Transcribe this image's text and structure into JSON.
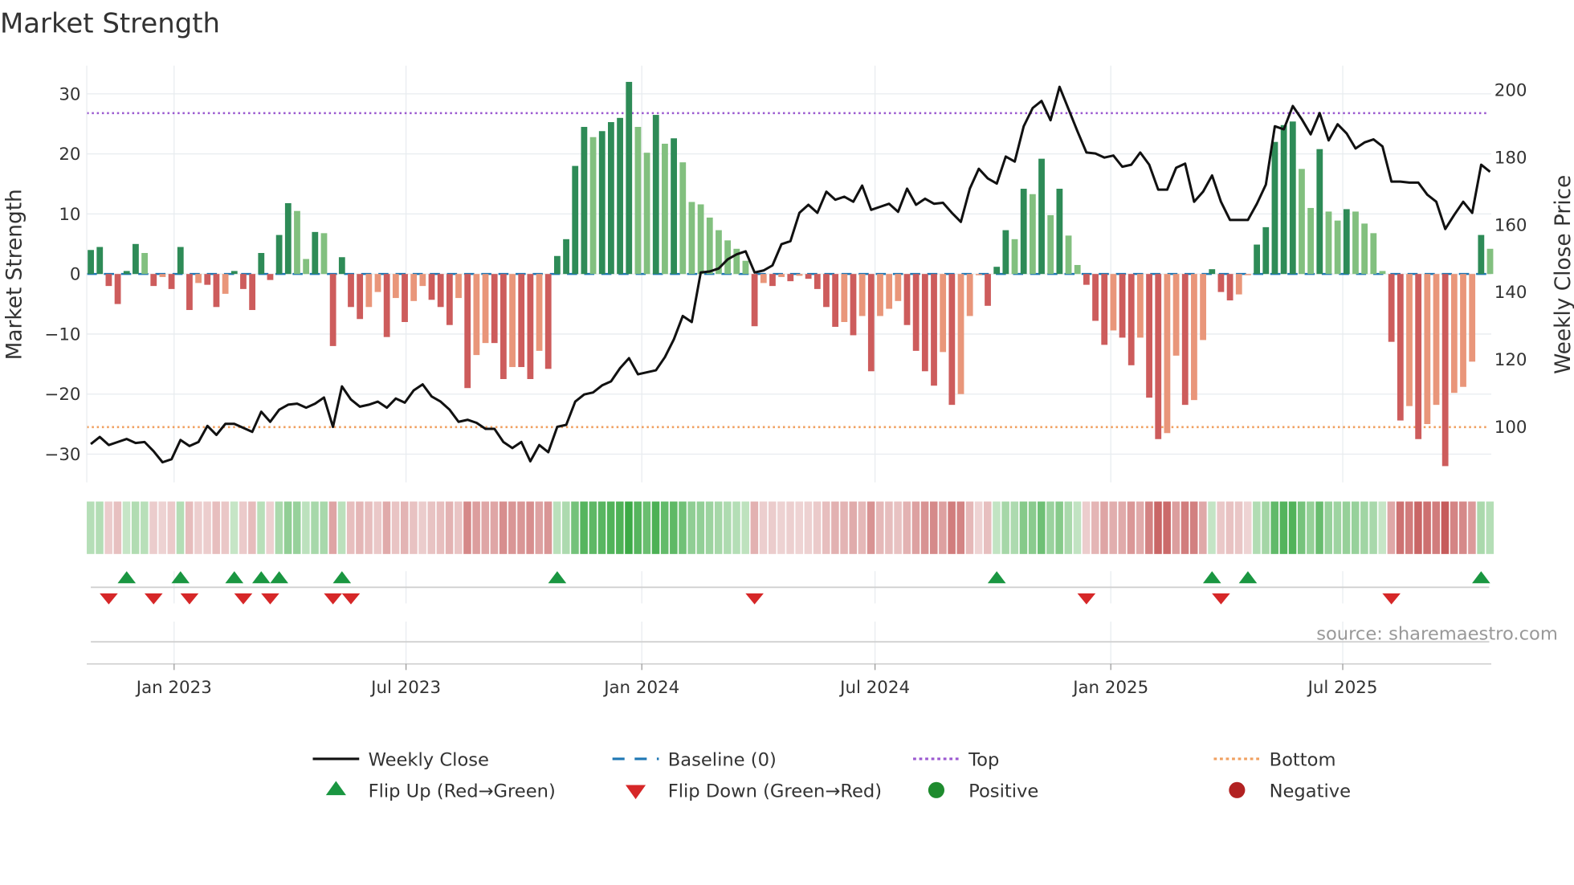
{
  "title": "Market Strength",
  "source": "source: sharemaestro.com",
  "colors": {
    "pos_rising": "#2e8b57",
    "pos_falling": "#82c07f",
    "neg_rising": "#cd5c5c",
    "neg_falling": "#e9967a",
    "close": "#111111",
    "baseline": "#1f77b4",
    "top": "#9b59d0",
    "bottom": "#f0a060",
    "flip_up": "#1a9641",
    "flip_down": "#d62728",
    "positive": "#1e8b2e",
    "negative": "#b22222"
  },
  "chart_data": {
    "type": "bar",
    "title": "Market Strength",
    "ylabel": "Market Strength",
    "y2label": "Weekly Close Price",
    "ylim": [
      -35,
      35
    ],
    "y2lim": [
      85,
      204
    ],
    "yticks": [
      30,
      20,
      10,
      0,
      -10,
      -20,
      -30
    ],
    "ytick_labels": [
      "30",
      "20",
      "10",
      "0",
      "−10",
      "−20",
      "−30"
    ],
    "y2ticks": [
      200,
      180,
      160,
      140,
      120,
      100
    ],
    "y2tick_labels": [
      "200",
      "180",
      "160",
      "140",
      "120",
      "100"
    ],
    "start_date": "2022-10-28",
    "frequency": "weekly",
    "xticks": [
      {
        "date": "2023-01-01",
        "label": "Jan 2023"
      },
      {
        "date": "2023-07-01",
        "label": "Jul 2023"
      },
      {
        "date": "2024-01-01",
        "label": "Jan 2024"
      },
      {
        "date": "2024-07-01",
        "label": "Jul 2024"
      },
      {
        "date": "2025-01-01",
        "label": "Jan 2025"
      },
      {
        "date": "2025-07-01",
        "label": "Jul 2025"
      }
    ],
    "top_level": 26.8,
    "bottom_level": -25.5,
    "baseline": 0,
    "strength": [
      4,
      4.5,
      -2,
      -5,
      0.5,
      5,
      3.5,
      -2,
      -0.5,
      -2.5,
      4.5,
      -6,
      -1.5,
      -1.8,
      -5.5,
      -3.3,
      0.5,
      -2.5,
      -6,
      3.5,
      -1,
      6.5,
      11.8,
      10.5,
      2.5,
      7,
      6.8,
      -12,
      2.8,
      -5.5,
      -7.5,
      -5.5,
      -3,
      -10.5,
      -4,
      -8,
      -4.5,
      -2,
      -4.3,
      -5.5,
      -8.5,
      -4,
      -19,
      -13.5,
      -11.5,
      -11.5,
      -17.5,
      -15.5,
      -15.5,
      -17.5,
      -12.8,
      -15.8,
      3,
      5.8,
      18,
      24.5,
      22.8,
      23.8,
      25.3,
      26,
      32,
      24.5,
      20.2,
      26.5,
      21.7,
      22.6,
      18.6,
      12,
      11.6,
      9.4,
      7.3,
      5.6,
      4.2,
      2.2,
      -8.7,
      -1.5,
      -2,
      -0.5,
      -1.2,
      -0.3,
      -0.8,
      -2.5,
      -5.5,
      -8.8,
      -8,
      -10.2,
      -7,
      -16.2,
      -7,
      -5.8,
      -4.5,
      -8.5,
      -12.8,
      -16.2,
      -18.6,
      -13,
      -21.8,
      -20,
      -7,
      -0.2,
      -5.3,
      1.2,
      7.3,
      5.8,
      14.2,
      13.3,
      19.2,
      9.8,
      14.2,
      6.4,
      1.5,
      -1.8,
      -7.8,
      -11.8,
      -9.4,
      -10.6,
      -15.2,
      -10.6,
      -20.6,
      -27.5,
      -26.5,
      -13.6,
      -21.8,
      -21,
      -11,
      0.8,
      -3,
      -4.4,
      -3.4,
      -0.2,
      4.9,
      7.8,
      22,
      24.8,
      25.4,
      17.5,
      11,
      20.8,
      10.4,
      8.9,
      10.8,
      10.4,
      8.4,
      6.8,
      0.5,
      -11.3,
      -24.4,
      -22,
      -27.5,
      -25,
      -21.8,
      -32,
      -19.8,
      -18.8,
      -14.6,
      6.5,
      4.2
    ],
    "weekly_close": [
      94.6,
      96.7,
      94.3,
      95.2,
      96.1,
      94.9,
      95.2,
      92.5,
      89.2,
      90.1,
      95.8,
      94.0,
      95.2,
      100,
      97.3,
      100.6,
      100.6,
      99.4,
      98.2,
      104.2,
      101.2,
      104.8,
      106.3,
      106.6,
      105.4,
      106.6,
      108.4,
      99.7,
      111.7,
      107.8,
      105.7,
      106.3,
      107.2,
      105.4,
      108.1,
      106.9,
      110.5,
      112.3,
      108.7,
      107.2,
      104.8,
      101.2,
      101.8,
      100.9,
      99.1,
      99.1,
      95.2,
      93.4,
      95.2,
      89.5,
      94.3,
      92.2,
      99.7,
      100.3,
      107.2,
      109.3,
      109.9,
      112.0,
      113.2,
      117.1,
      120.1,
      115.3,
      115.9,
      116.5,
      120.4,
      125.7,
      132.6,
      130.8,
      145.5,
      145.8,
      146.7,
      149.4,
      150.9,
      151.8,
      145.5,
      146.1,
      147.6,
      153.9,
      154.8,
      163.2,
      165.6,
      163.2,
      169.5,
      167.1,
      168.0,
      166.5,
      171.3,
      164.1,
      165.0,
      165.9,
      163.5,
      170.4,
      165.6,
      167.4,
      165.9,
      166.2,
      163.2,
      160.5,
      170.4,
      176.3,
      173.4,
      171.9,
      179.9,
      178.4,
      188.9,
      194.3,
      196.4,
      190.7,
      200.6,
      194.0,
      187.4,
      181.1,
      180.8,
      179.6,
      180.2,
      176.9,
      177.5,
      181.1,
      177.5,
      170.1,
      170.1,
      176.6,
      177.8,
      166.5,
      169.5,
      174.3,
      166.5,
      161.1,
      161.1,
      161.1,
      165.9,
      171.6,
      188.9,
      188.0,
      194.9,
      191.0,
      186.5,
      192.8,
      184.7,
      189.5,
      186.8,
      182.3,
      184.1,
      185.0,
      182.9,
      172.5,
      172.5,
      172.2,
      172.2,
      168.6,
      166.5,
      158.4,
      162.6,
      166.5,
      163.2,
      177.5,
      175.4
    ],
    "flip_up_weeks": [
      4,
      10,
      16,
      19,
      21,
      28,
      52,
      101,
      125,
      129,
      155
    ],
    "flip_down_weeks": [
      2,
      7,
      11,
      17,
      20,
      27,
      29,
      74,
      111,
      126,
      145
    ],
    "legend": {
      "placement": "bottom",
      "items": [
        {
          "label": "Weekly Close",
          "symbol": "line"
        },
        {
          "label": "Baseline (0)",
          "symbol": "dash"
        },
        {
          "label": "Top",
          "symbol": "dot"
        },
        {
          "label": "Bottom",
          "symbol": "dot"
        },
        {
          "label": "Flip Up (Red→Green)",
          "symbol": "triangle-up"
        },
        {
          "label": "Flip Down (Green→Red)",
          "symbol": "triangle-down"
        },
        {
          "label": "Positive",
          "symbol": "circle"
        },
        {
          "label": "Negative",
          "symbol": "circle"
        }
      ]
    }
  }
}
